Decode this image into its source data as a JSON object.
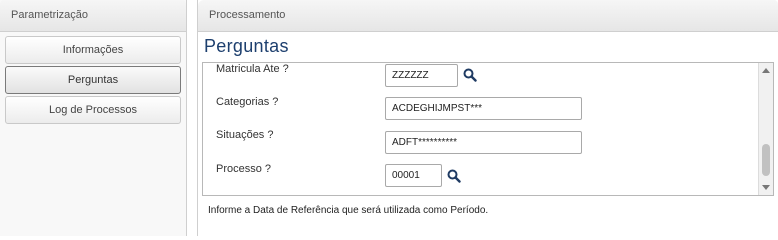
{
  "left": {
    "header": "Parametrização",
    "nav": [
      {
        "label": "Informações",
        "active": false
      },
      {
        "label": "Perguntas",
        "active": true
      },
      {
        "label": "Log de Processos",
        "active": false
      }
    ]
  },
  "right": {
    "header": "Processamento",
    "title": "Perguntas",
    "questions": [
      {
        "label": "Matricula Ate ?",
        "value": "ZZZZZZ",
        "has_search": true
      },
      {
        "label": "Categorias ?",
        "value": "ACDEGHIJMPST***",
        "has_search": false
      },
      {
        "label": "Situações ?",
        "value": "ADFT**********",
        "has_search": false
      },
      {
        "label": "Processo ?",
        "value": "00001",
        "has_search": true
      }
    ],
    "help_text": "Informe a Data de Referência que será utilizada como Período."
  },
  "icons": {
    "search": "search-icon"
  },
  "colors": {
    "title": "#1d3f6e",
    "search_icon": "#1f3b63"
  }
}
